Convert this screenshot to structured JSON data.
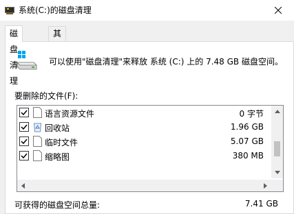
{
  "window": {
    "title": "系统(C:)的磁盘清理",
    "close_icon": "close-icon"
  },
  "tabs": [
    {
      "label": "磁盘清理",
      "active": true
    },
    {
      "label": "其他选项",
      "active": false
    }
  ],
  "summary": "可以使用\"磁盘清理\"来释放 系统 (C:) 上的 7.48 GB 磁盘空间。",
  "list_label": "要删除的文件(F):",
  "files": [
    {
      "name": "语言资源文件",
      "size": "0 字节",
      "checked": true,
      "icon": "file-icon"
    },
    {
      "name": "回收站",
      "size": "1.96 GB",
      "checked": true,
      "icon": "recycle-bin-icon"
    },
    {
      "name": "临时文件",
      "size": "5.07 GB",
      "checked": true,
      "icon": "file-icon"
    },
    {
      "name": "缩略图",
      "size": "380 MB",
      "checked": true,
      "icon": "file-icon"
    }
  ],
  "total": {
    "label": "可获得的磁盘空间总量:",
    "value": "7.41 GB"
  }
}
